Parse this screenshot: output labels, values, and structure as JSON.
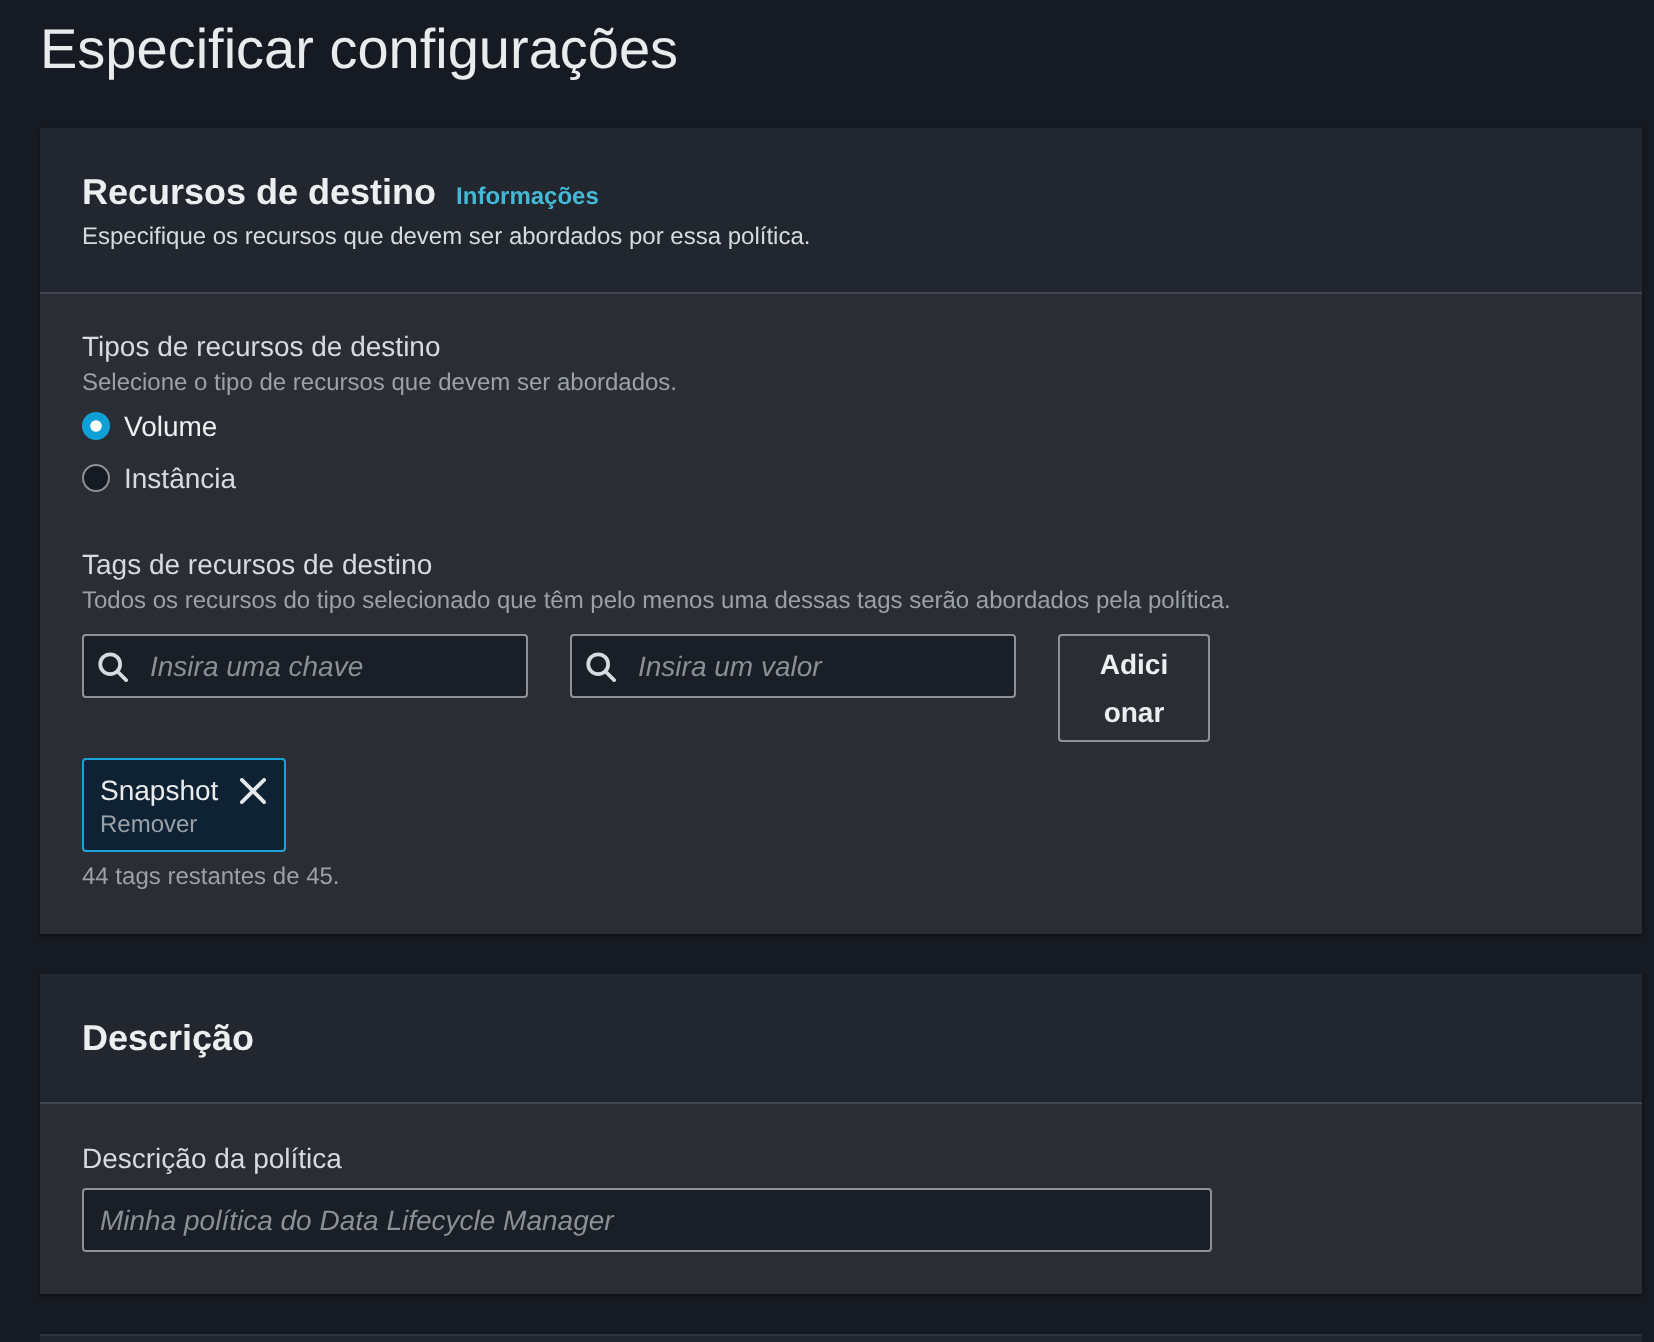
{
  "page": {
    "title": "Especificar configurações"
  },
  "target_resources": {
    "title": "Recursos de destino",
    "info_link": "Informações",
    "description": "Especifique os recursos que devem ser abordados por essa política.",
    "resource_types": {
      "label": "Tipos de recursos de destino",
      "hint": "Selecione o tipo de recursos que devem ser abordados.",
      "options": [
        {
          "label": "Volume",
          "selected": true
        },
        {
          "label": "Instância",
          "selected": false
        }
      ]
    },
    "tags": {
      "label": "Tags de recursos de destino",
      "hint": "Todos os recursos do tipo selecionado que têm pelo menos uma dessas tags serão abordados pela política.",
      "key_field": {
        "placeholder": "Insira uma chave"
      },
      "value_field": {
        "placeholder": "Insira um valor"
      },
      "add_button": "Adicionar",
      "tokens": [
        {
          "label": "Snapshot",
          "action": "Remover"
        }
      ],
      "remaining": "44 tags restantes de 45."
    }
  },
  "description_section": {
    "title": "Descrição",
    "field": {
      "label": "Descrição da política",
      "placeholder": "Minha política do Data Lifecycle Manager"
    }
  }
}
